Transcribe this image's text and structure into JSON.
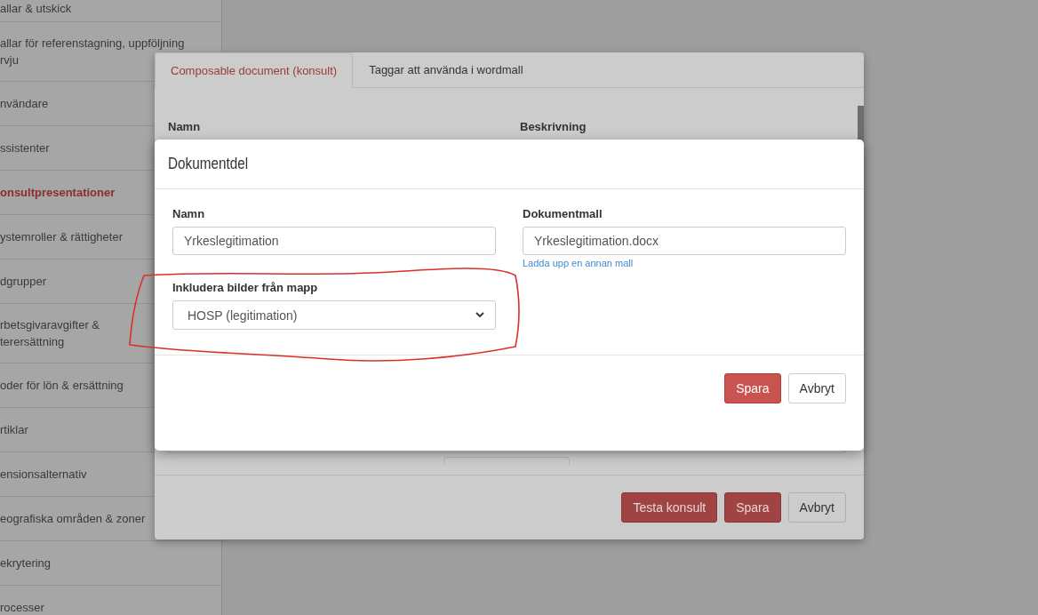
{
  "sidebar": {
    "items": [
      {
        "label": "allar & utskick",
        "selected": false
      },
      {
        "label": "allar för referenstagning, uppföljning\nrvju",
        "selected": false
      },
      {
        "label": "nvändare",
        "selected": false
      },
      {
        "label": "ssistenter",
        "selected": false
      },
      {
        "label": "onsultpresentationer",
        "selected": true
      },
      {
        "label": "ystemroller & rättigheter",
        "selected": false
      },
      {
        "label": "dgrupper",
        "selected": false
      },
      {
        "label": "rbetsgivaravgifter &\nterersättning",
        "selected": false
      },
      {
        "label": "oder för lön & ersättning",
        "selected": false
      },
      {
        "label": "rtiklar",
        "selected": false
      },
      {
        "label": "ensionsalternativ",
        "selected": false
      },
      {
        "label": "eografiska områden & zoner",
        "selected": false
      },
      {
        "label": "ekrytering",
        "selected": false
      },
      {
        "label": "rocesser",
        "selected": false
      }
    ]
  },
  "back_dialog": {
    "tabs": [
      {
        "label": "Composable document (konsult)",
        "selected": true
      },
      {
        "label": "Taggar att använda i wordmall",
        "selected": false
      }
    ],
    "table": {
      "columns": [
        "Namn",
        "Beskrivning"
      ]
    },
    "buttons": [
      {
        "label": "Testa konsult",
        "kind": "danger"
      },
      {
        "label": "Spara",
        "kind": "danger"
      },
      {
        "label": "Avbryt",
        "kind": "default"
      }
    ]
  },
  "dialog": {
    "title": "Dokumentdel",
    "name": {
      "label": "Namn",
      "value": "Yrkeslegitimation"
    },
    "template": {
      "label": "Dokumentmall",
      "value": "Yrkeslegitimation.docx",
      "link": "Ladda upp en annan mall"
    },
    "folder": {
      "label": "Inkludera bilder från mapp",
      "value": "HOSP (legitimation)"
    },
    "buttons": [
      {
        "label": "Spara",
        "kind": "primary"
      },
      {
        "label": "Avbryt",
        "kind": "default"
      }
    ]
  }
}
